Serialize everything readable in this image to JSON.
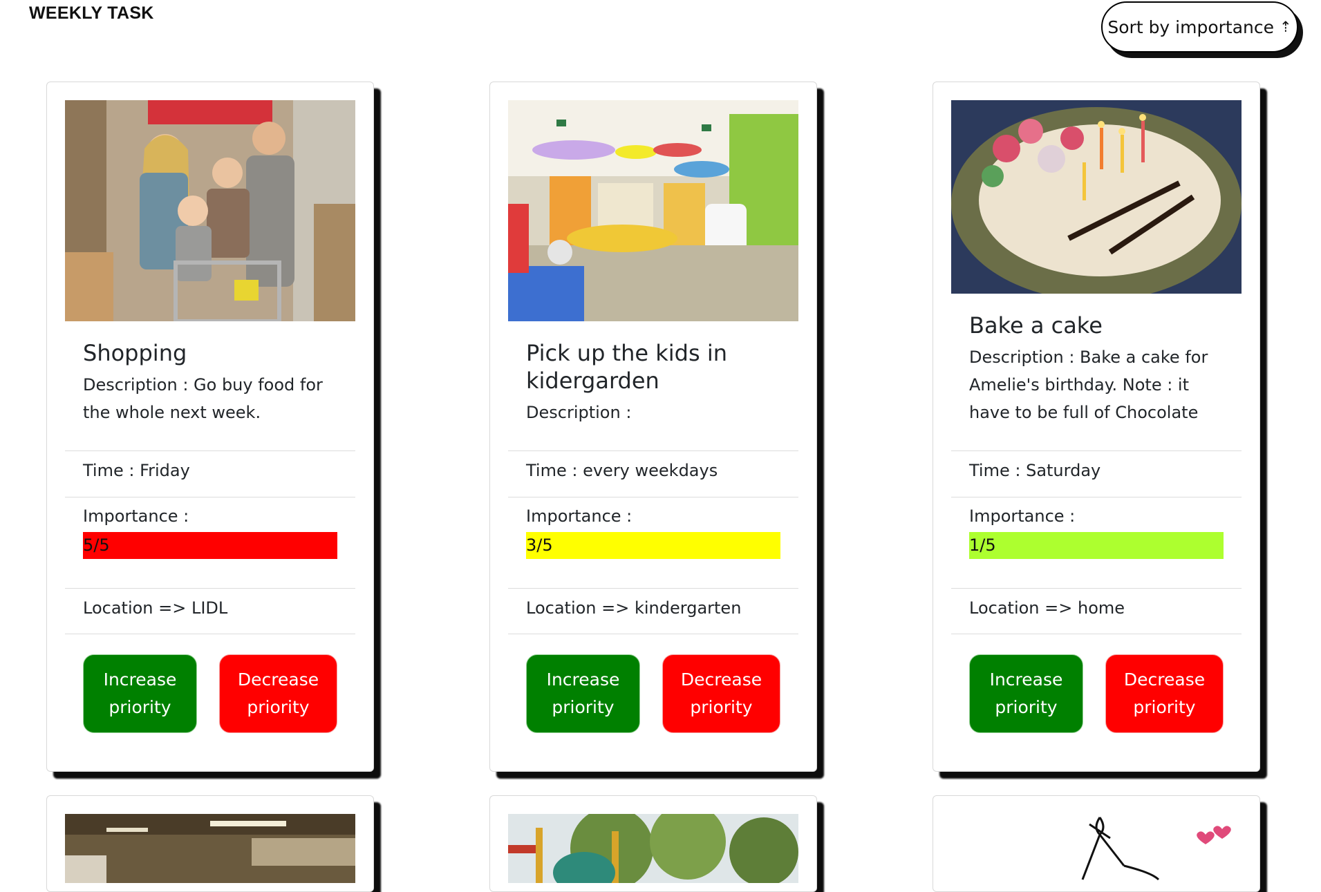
{
  "header": {
    "title": "WEEKLY TASK",
    "sort_label": "Sort by importance",
    "sort_arrow": "⇡"
  },
  "colors": {
    "increase": "#008000",
    "decrease": "#ff0000",
    "imp5": "#ff0000",
    "imp3": "#ffff00",
    "imp1": "#adff2f"
  },
  "cards": [
    {
      "image": "family-shopping-photo",
      "title": "Shopping",
      "description": "Description : Go buy food for the whole next week.",
      "time": "Time : Friday",
      "importance_label": "Importance :",
      "importance_text": "5/5",
      "importance_value": 5,
      "location": "Location => LIDL",
      "increase": "Increase priority",
      "decrease": "Decrease priority"
    },
    {
      "image": "kindergarten-interior-photo",
      "title": "Pick up the kids in kidergarden",
      "description": "Description :",
      "time": "Time : every weekdays",
      "importance_label": "Importance :",
      "importance_text": "3/5",
      "importance_value": 3,
      "location": "Location => kindergarten",
      "increase": "Increase priority",
      "decrease": "Decrease priority"
    },
    {
      "image": "birthday-cake-photo",
      "title": "Bake a cake",
      "description": "Description : Bake a cake for Amelie's birthday. Note : it have to be full of Chocolate",
      "time": "Time : Saturday",
      "importance_label": "Importance :",
      "importance_text": "1/5",
      "importance_value": 1,
      "location": "Location => home",
      "increase": "Increase priority",
      "decrease": "Decrease priority"
    }
  ],
  "partial_cards": [
    {
      "image": "store-interior-photo"
    },
    {
      "image": "playground-photo"
    },
    {
      "image": "heart-doodle-drawing"
    }
  ]
}
